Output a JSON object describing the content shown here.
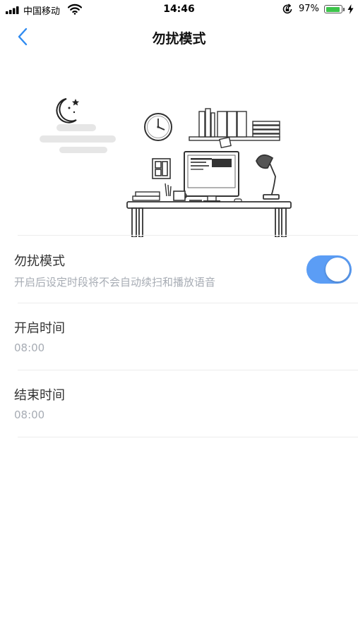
{
  "status_bar": {
    "carrier": "中国移动",
    "time": "14:46",
    "battery_percent": "97%",
    "battery_level": 0.97,
    "icons": [
      "signal-bars-icon",
      "wifi-icon",
      "rotation-lock-icon",
      "battery-icon",
      "charging-bolt-icon"
    ]
  },
  "nav": {
    "title": "勿扰模式",
    "back_icon": "chevron-left-icon"
  },
  "dnd": {
    "title": "勿扰模式",
    "description": "开启后设定时段将不会自动续扫和播放语音",
    "enabled": true
  },
  "start_time": {
    "label": "开启时间",
    "value": "08:00"
  },
  "end_time": {
    "label": "结束时间",
    "value": "08:00"
  },
  "colors": {
    "accent": "#5b9df5",
    "subtext": "#a7acb4",
    "divider": "#ececec"
  }
}
